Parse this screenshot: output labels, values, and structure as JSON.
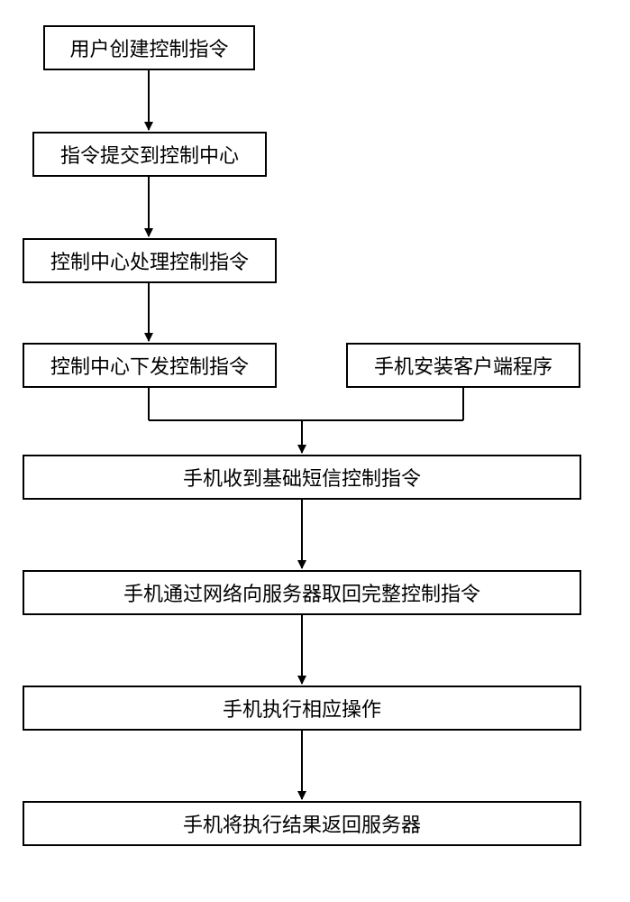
{
  "steps": {
    "s1": "用户创建控制指令",
    "s2": "指令提交到控制中心",
    "s3": "控制中心处理控制指令",
    "s4": "控制中心下发控制指令",
    "s4b": "手机安装客户端程序",
    "s5": "手机收到基础短信控制指令",
    "s6": "手机通过网络向服务器取回完整控制指令",
    "s7": "手机执行相应操作",
    "s8": "手机将执行结果返回服务器"
  }
}
